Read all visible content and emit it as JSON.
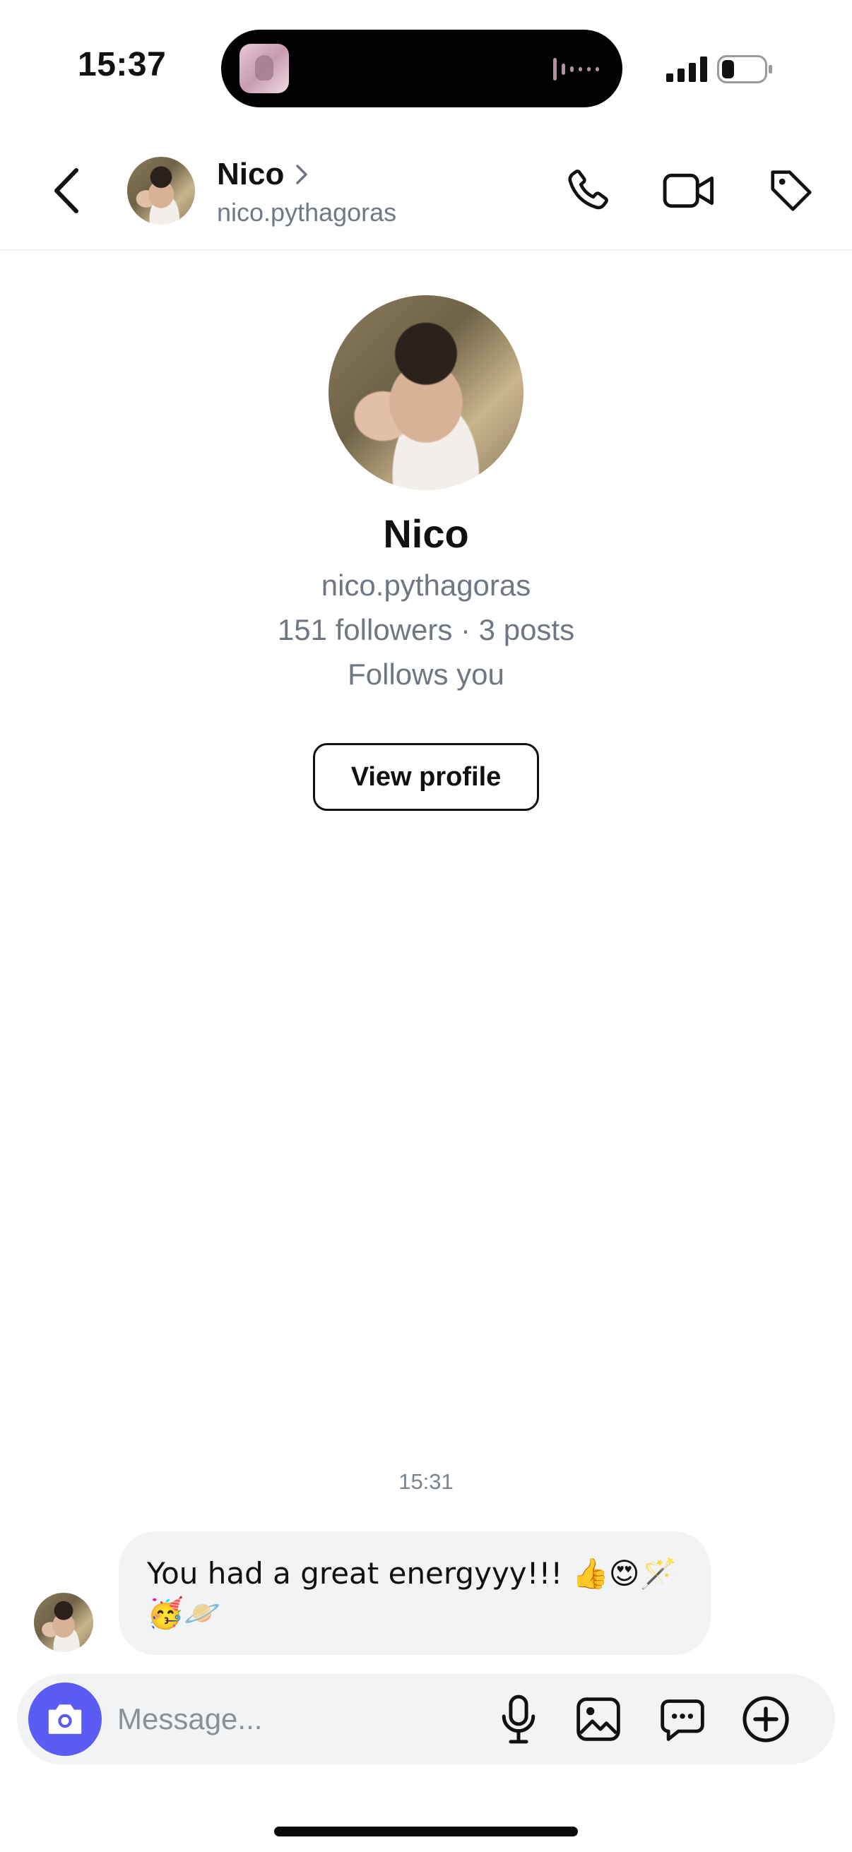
{
  "status_bar": {
    "time": "15:37",
    "icons": [
      "now-playing-app-icon",
      "audio-waveform-icon",
      "cellular-signal-icon",
      "battery-icon"
    ]
  },
  "header": {
    "name": "Nico",
    "username": "nico.pythagoras",
    "icons": [
      "back-chevron-icon",
      "chevron-right-icon",
      "phone-icon",
      "video-camera-icon",
      "tag-icon"
    ]
  },
  "profile": {
    "name": "Nico",
    "username": "nico.pythagoras",
    "stats": "151 followers · 3 posts",
    "follows_status": "Follows you",
    "view_profile_label": "View profile"
  },
  "conversation": {
    "timestamp": "15:31",
    "messages": [
      {
        "text": "You had a great energyyy!!! 👍😍🪄🥳🪐"
      }
    ]
  },
  "composer": {
    "placeholder": "Message...",
    "icons": [
      "camera-icon",
      "microphone-icon",
      "gallery-icon",
      "chat-bubble-icon",
      "add-circle-icon"
    ]
  },
  "colors": {
    "accent": "#5b5bf5",
    "bubble_bg": "#f2f3f5",
    "secondary_text": "#6f7782"
  }
}
